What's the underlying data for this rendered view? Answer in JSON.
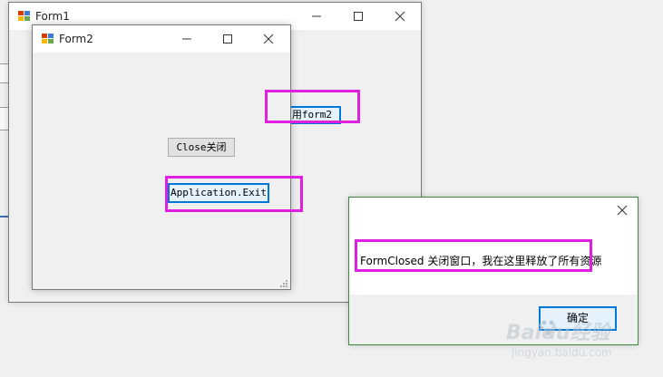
{
  "form1": {
    "title": "Form1",
    "call_button_label": "用form2"
  },
  "form2": {
    "title": "Form2",
    "close_button_label": "Close关闭",
    "exit_button_label": "Application.Exit"
  },
  "messagebox": {
    "message": "FormClosed 关闭窗口，我在这里释放了所有资源",
    "ok_button_label": "确定"
  },
  "watermark": {
    "brand": "Baidu经验",
    "url": "jingyan.baidu.com"
  },
  "colors": {
    "highlight": "#e020e0",
    "focus_border": "#0078d7",
    "dialog_border": "#3c8a3c"
  }
}
